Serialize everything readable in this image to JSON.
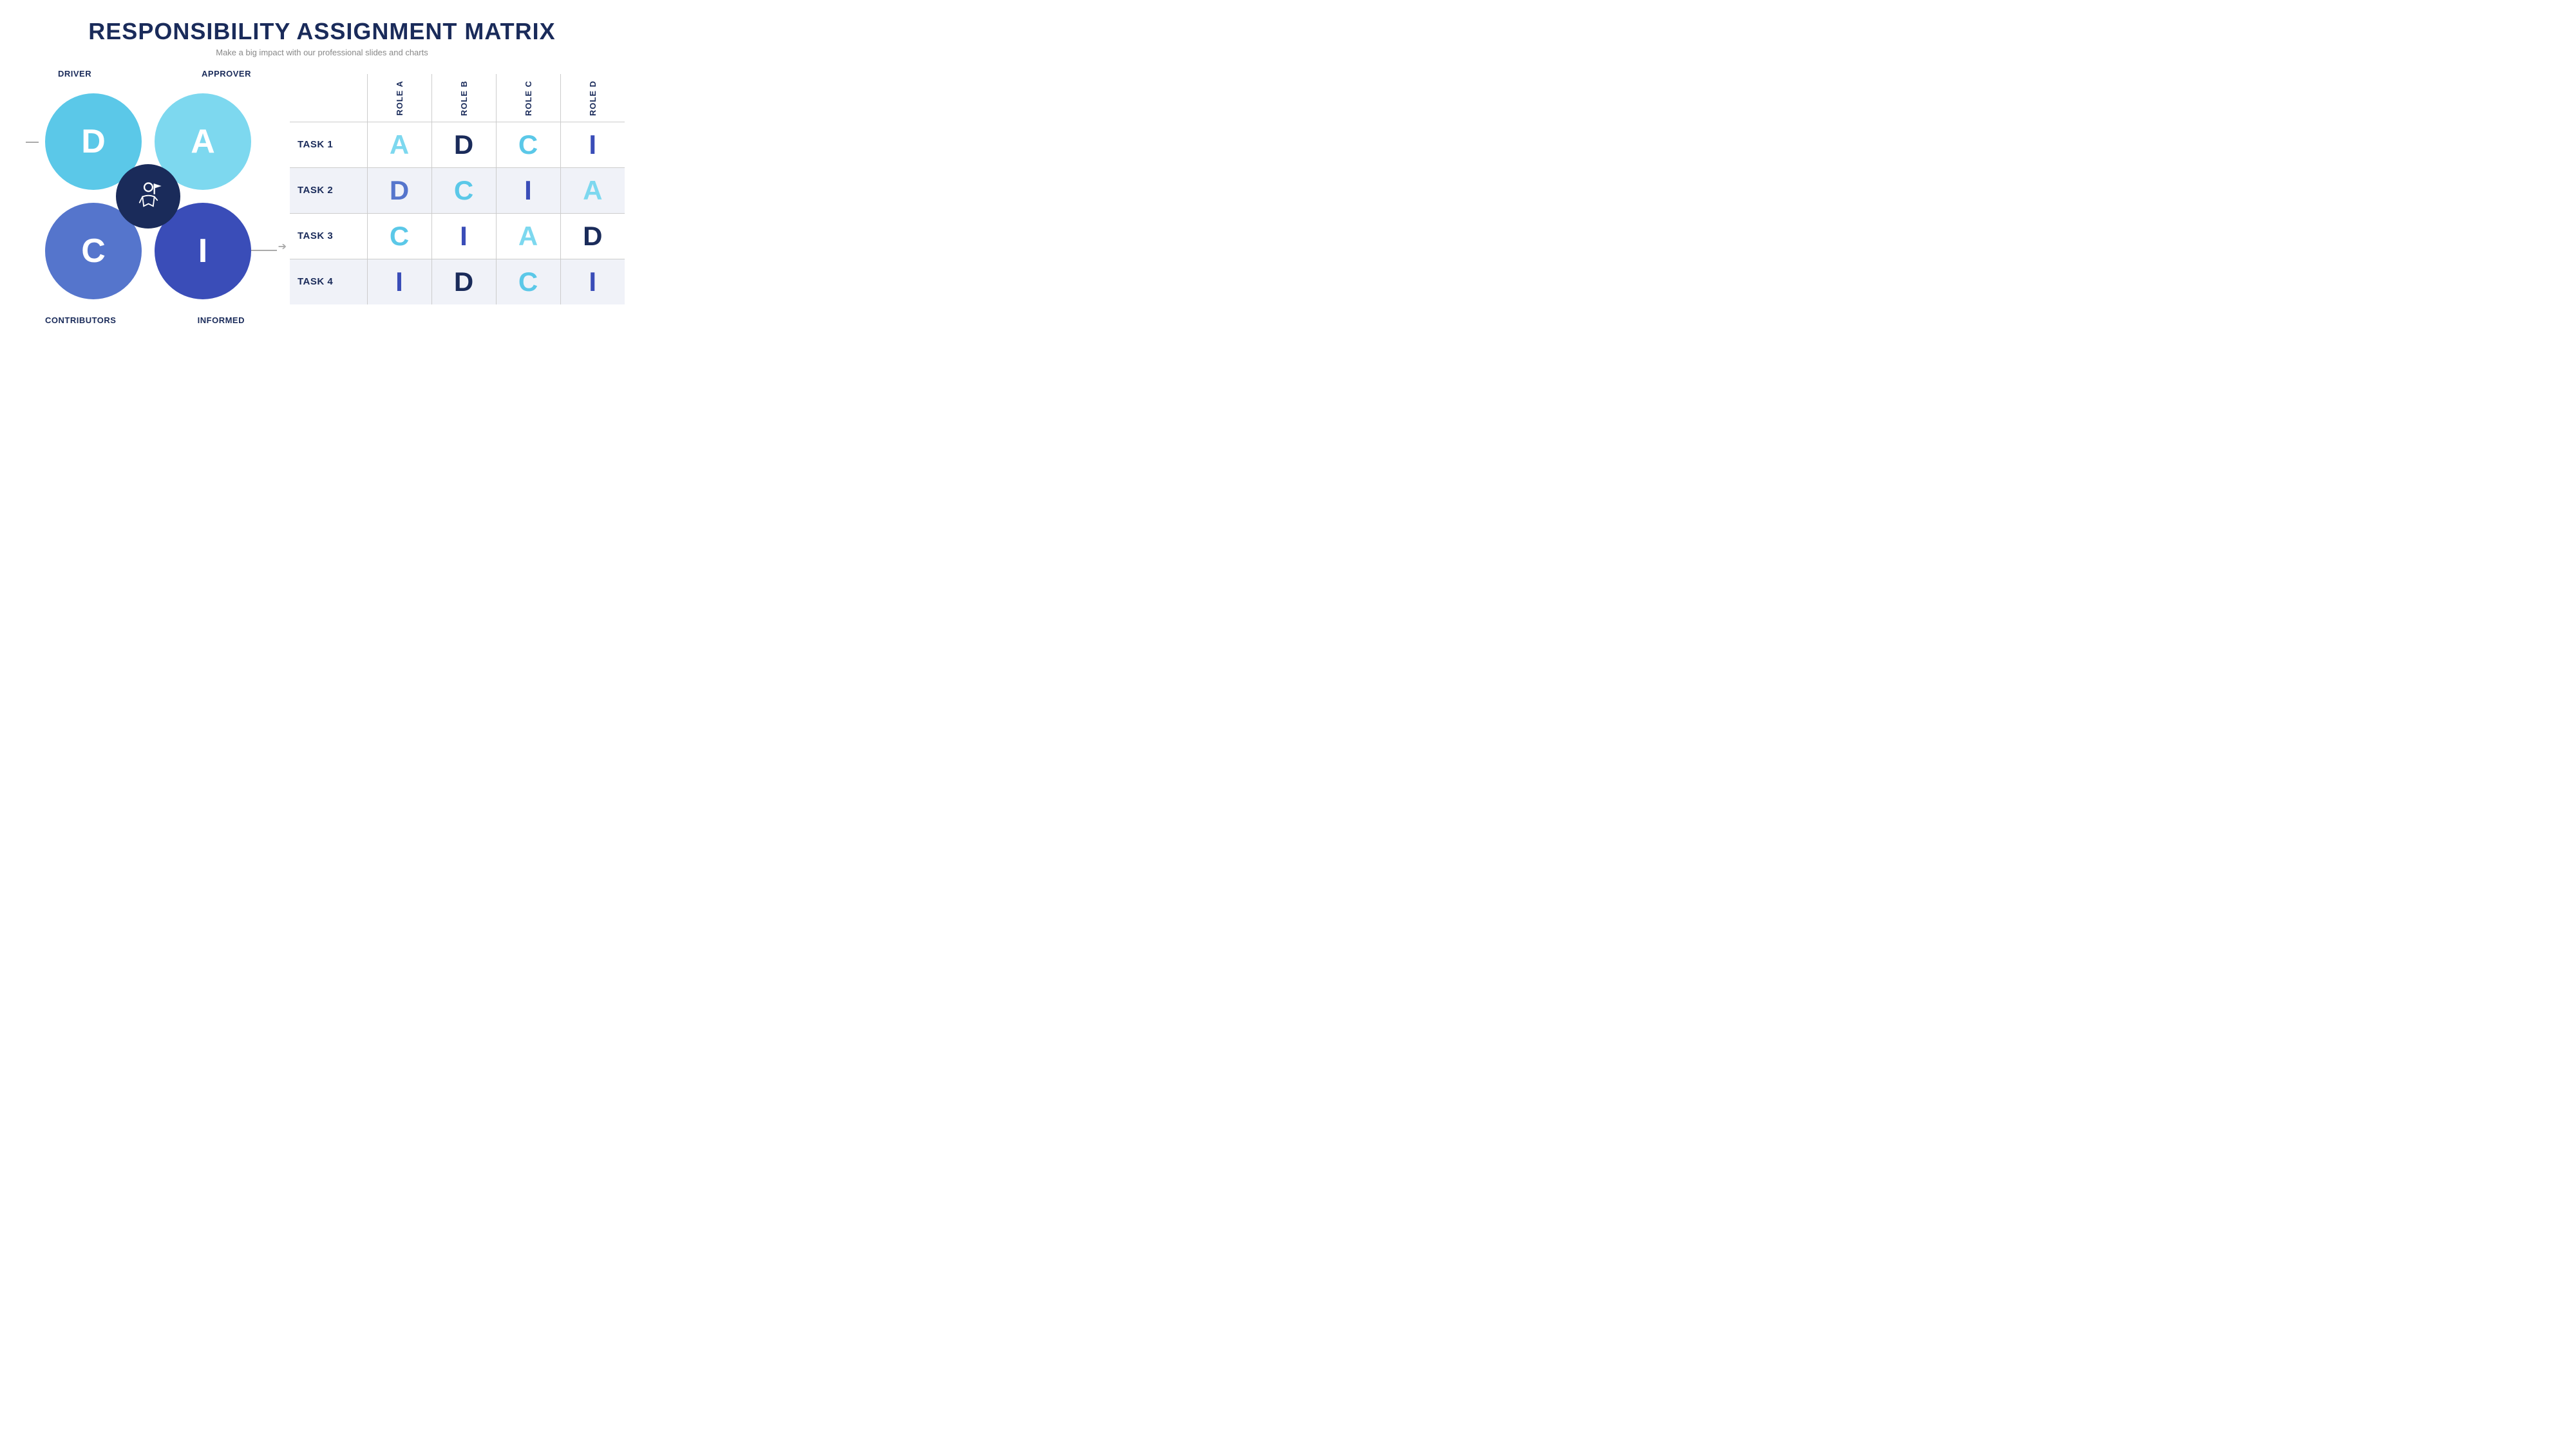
{
  "header": {
    "title": "RESPONSIBILITY ASSIGNMENT MATRIX",
    "subtitle": "Make a big impact with our professional slides and charts"
  },
  "daci": {
    "driver_label": "DRIVER",
    "approver_label": "APPROVER",
    "contributors_label": "CONTRIBUTORS",
    "informed_label": "INFORMED",
    "d_letter": "D",
    "a_letter": "A",
    "c_letter": "C",
    "i_letter": "I"
  },
  "matrix": {
    "roles": [
      "ROLE A",
      "ROLE B",
      "ROLE C",
      "ROLE D"
    ],
    "rows": [
      {
        "task": "TASK 1",
        "shaded": false,
        "cells": [
          {
            "letter": "A",
            "class": "letter-a"
          },
          {
            "letter": "D",
            "class": "letter-d-dark"
          },
          {
            "letter": "C",
            "class": "letter-c"
          },
          {
            "letter": "I",
            "class": "letter-i"
          }
        ]
      },
      {
        "task": "TASK 2",
        "shaded": true,
        "cells": [
          {
            "letter": "D",
            "class": "letter-d-mid"
          },
          {
            "letter": "C",
            "class": "letter-c"
          },
          {
            "letter": "I",
            "class": "letter-i"
          },
          {
            "letter": "A",
            "class": "letter-a"
          }
        ]
      },
      {
        "task": "TASK 3",
        "shaded": false,
        "cells": [
          {
            "letter": "C",
            "class": "letter-c"
          },
          {
            "letter": "I",
            "class": "letter-i"
          },
          {
            "letter": "A",
            "class": "letter-a"
          },
          {
            "letter": "D",
            "class": "letter-d-dark"
          }
        ]
      },
      {
        "task": "TASK 4",
        "shaded": true,
        "cells": [
          {
            "letter": "I",
            "class": "letter-i"
          },
          {
            "letter": "D",
            "class": "letter-d-dark"
          },
          {
            "letter": "C",
            "class": "letter-c"
          },
          {
            "letter": "I",
            "class": "letter-i"
          }
        ]
      }
    ]
  }
}
